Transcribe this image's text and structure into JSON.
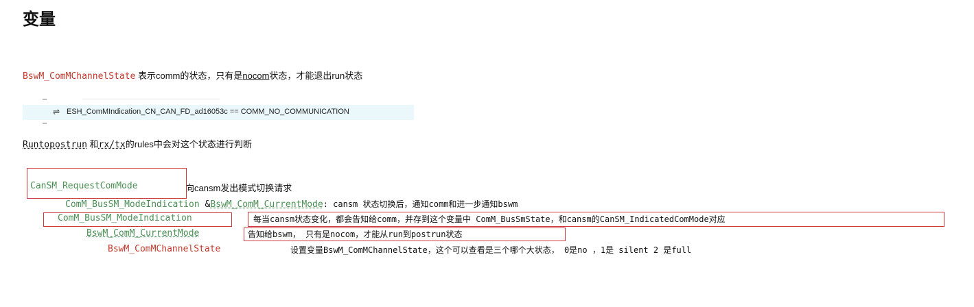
{
  "heading": "变量",
  "line1": {
    "var": "BswM_ComMChannelState",
    "text_a": " 表示comm的状态，只有是",
    "link": "nocom",
    "text_b": "状态，才能退出run状态"
  },
  "snippet": {
    "icon": "equals-icon",
    "text": "ESH_ComMIndication_CN_CAN_FD_ad16053c == COMM_NO_COMMUNICATION"
  },
  "line2": {
    "var": "Runtopostrun",
    "text_a": " 和",
    "link": "rx/tx",
    "text_b": "的rules中会对这个状态进行判断"
  },
  "line3": {
    "var": "CanSM_RequestComMode",
    "text": "向cansm发出模式切换请求"
  },
  "line4": {
    "var_a": "ComM_BusSM_ModeIndication",
    "amp": " &",
    "var_b": "BswM_ComM_CurrentMode",
    "text": ": cansm 状态切换后，通知comm和进一步通知bswm"
  },
  "line5": {
    "var": "ComM_BusSM_ModeIndication",
    "text": "每当cansm状态变化，都会告知给comm，并存到这个变量中 ComM_BusSmState，和cansm的CanSM_IndicatedComMode对应"
  },
  "line6": {
    "var": "BswM_ComM_CurrentMode",
    "text": "告知给bswm，  只有是nocom，才能从run到postrun状态"
  },
  "line7": {
    "var": "BswM_ComMChannelState",
    "text": "设置变量BswM_ComMChannelState，这个可以查看是三个哪个大状态，  0是no ，1是 silent  2 是full"
  },
  "colors": {
    "red_var": "#c0392b",
    "green_var": "#4b8f55",
    "box_border": "#d0363d",
    "snippet_bg": "#eaf7fb"
  }
}
